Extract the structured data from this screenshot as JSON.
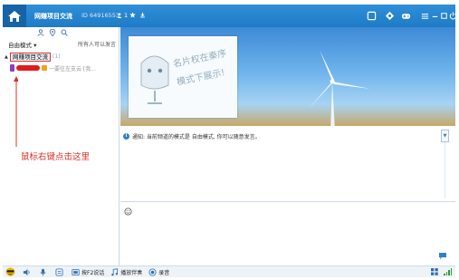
{
  "titlebar": {
    "title": "网赚项目交流",
    "room_id": "ID 64916553",
    "user_count": "1",
    "icons": [
      "home-icon",
      "user-icon",
      "star-icon",
      "download-icon",
      "square-icon",
      "clover-icon",
      "gamepad-icon",
      "menu-icon",
      "minimize-icon",
      "maximize-icon",
      "power-icon"
    ]
  },
  "left_panel": {
    "tool_icons": [
      "people-icon",
      "location-icon",
      "search-icon"
    ],
    "mode_label": "自由模式",
    "mode_arrow": "▾",
    "all_speak": "所有人可以发言",
    "room": {
      "expand": "▲",
      "name": "网赚项目交流",
      "count": "(1)"
    },
    "member": {
      "text": "一要往左支云 [我..."
    },
    "annotation": "鼠标右键点击这里"
  },
  "banner": {
    "card_text": "名片权在秦序\n模式下展示!"
  },
  "notice": {
    "icon_label": "i",
    "text": "通知: 当前频道的模式是 自由模式, 你可以随意发言。"
  },
  "bottom_bar": {
    "items": [
      {
        "icon": "speaker-icon",
        "label": ""
      },
      {
        "icon": "microphone-icon",
        "label": ""
      },
      {
        "icon": "keyboard-icon",
        "label": ""
      },
      {
        "icon": "push-to-talk-icon",
        "label": "按F2说话"
      },
      {
        "icon": "music-icon",
        "label": "播放伴奏"
      },
      {
        "icon": "record-icon",
        "label": "录音"
      }
    ]
  },
  "colors": {
    "titlebar": "#2585cf",
    "accent": "#2f7fc8",
    "annotation": "#d9302a",
    "redaction": "#e21b1b"
  }
}
